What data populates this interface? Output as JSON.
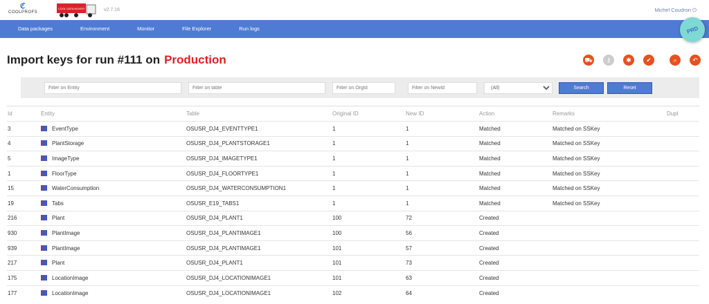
{
  "header": {
    "logo_text": "COOLPROFS",
    "product_logo_text": "COOL DATA MOVER",
    "version": "v2.7.16",
    "user": "Michel Coudron",
    "env_badge": "PRD"
  },
  "nav": [
    "Data packages",
    "Environment",
    "Monitor",
    "File Explorer",
    "Run logs"
  ],
  "page": {
    "title": "Import keys for run #111 on",
    "environment": "Production"
  },
  "actions": [
    {
      "icon": "truck-icon",
      "g": "⛟"
    },
    {
      "icon": "key-icon",
      "g": "⚷",
      "disabled": true
    },
    {
      "icon": "bug-icon",
      "g": "✱"
    },
    {
      "icon": "check-icon",
      "g": "✔"
    },
    {
      "icon": "search-icon",
      "g": "⌕"
    },
    {
      "icon": "undo-icon",
      "g": "↶"
    }
  ],
  "filters": {
    "entity_placeholder": "Filter on Entity",
    "table_placeholder": "Filter on table",
    "orgid_placeholder": "Filter on OrgId",
    "newid_placeholder": "Filter on NewId",
    "action_selected": "(All)",
    "search_label": "Search",
    "reset_label": "Reset"
  },
  "columns": [
    "Id",
    "Entity",
    "Table",
    "Original ID",
    "New ID",
    "Action",
    "Remarks",
    "Dupl"
  ],
  "rows": [
    [
      "3",
      "EventType",
      "OSUSR_DJ4_EVENTTYPE1",
      "1",
      "1",
      "Matched",
      "Matched on SSKey"
    ],
    [
      "4",
      "PlantStorage",
      "OSUSR_DJ4_PLANTSTORAGE1",
      "1",
      "1",
      "Matched",
      "Matched on SSKey"
    ],
    [
      "5",
      "ImageType",
      "OSUSR_DJ4_IMAGETYPE1",
      "1",
      "1",
      "Matched",
      "Matched on SSKey"
    ],
    [
      "1",
      "FloorType",
      "OSUSR_DJ4_FLOORTYPE1",
      "1",
      "1",
      "Matched",
      "Matched on SSKey"
    ],
    [
      "15",
      "WaterConsumption",
      "OSUSR_DJ4_WATERCONSUMPTION1",
      "1",
      "1",
      "Matched",
      "Matched on SSKey"
    ],
    [
      "19",
      "Tabs",
      "OSUSR_E19_TABS1",
      "1",
      "1",
      "Matched",
      "Matched on SSKey"
    ],
    [
      "216",
      "Plant",
      "OSUSR_DJ4_PLANT1",
      "100",
      "72",
      "Created",
      ""
    ],
    [
      "930",
      "PlantImage",
      "OSUSR_DJ4_PLANTIMAGE1",
      "100",
      "56",
      "Created",
      ""
    ],
    [
      "939",
      "PlantImage",
      "OSUSR_DJ4_PLANTIMAGE1",
      "101",
      "57",
      "Created",
      ""
    ],
    [
      "217",
      "Plant",
      "OSUSR_DJ4_PLANT1",
      "101",
      "73",
      "Created",
      ""
    ],
    [
      "175",
      "LocationImage",
      "OSUSR_DJ4_LOCATIONIMAGE1",
      "101",
      "63",
      "Created",
      ""
    ],
    [
      "177",
      "LocationImage",
      "OSUSR_DJ4_LOCATIONIMAGE1",
      "102",
      "64",
      "Created",
      ""
    ]
  ]
}
